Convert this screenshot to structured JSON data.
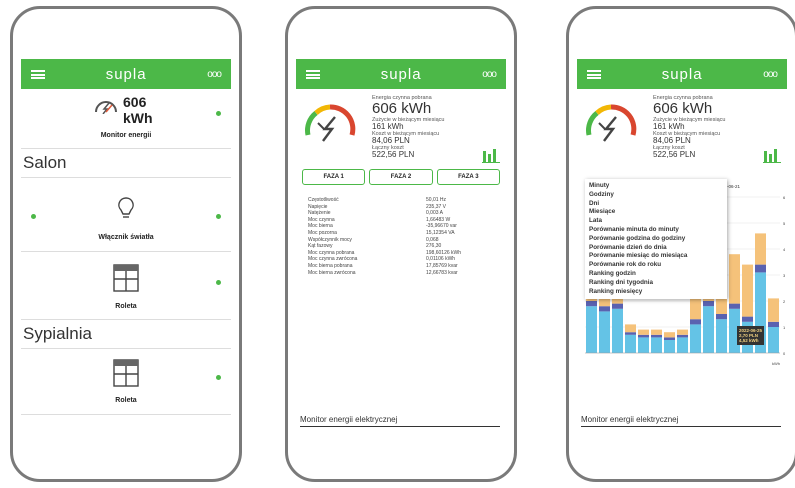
{
  "app": {
    "logo": "supla",
    "more": "ooo"
  },
  "phone1": {
    "energy_value": "606",
    "energy_unit": "kWh",
    "energy_label": "Monitor energii",
    "sections": [
      {
        "title": "Salon"
      },
      {
        "title": "Sypialnia"
      }
    ],
    "light_label": "Włącznik światła",
    "roller1_label": "Roleta",
    "roller2_label": "Roleta"
  },
  "monitor": {
    "top_caption": "Energia czynna pobrana",
    "total": "606 kWh",
    "month_caption": "Zużycie w bieżącym miesiącu",
    "month_value": "161 kWh",
    "cost_caption": "Koszt w bieżącym miesiącu",
    "cost_value": "84,06 PLN",
    "total_cost_caption": "Łączny koszt",
    "total_cost_value": "522,56 PLN",
    "footer": "Monitor energii elektrycznej"
  },
  "phone2": {
    "tabs": [
      "FAZA 1",
      "FAZA 2",
      "FAZA 3"
    ],
    "rows": [
      [
        "Częstotliwość",
        "50,01 Hz"
      ],
      [
        "Napięcie",
        "235,37 V"
      ],
      [
        "Natężenie",
        "0,003 A"
      ],
      [
        "Moc czynna",
        "1,66483 W"
      ],
      [
        "Moc bierna",
        "-35,96670 var"
      ],
      [
        "Moc pozorna",
        "15,12354 VA"
      ],
      [
        "Współczynnik mocy",
        "0,068"
      ],
      [
        "Kąt fazowy",
        "276,30"
      ],
      [
        "Moc czynna pobrana",
        "198,60126 kWh"
      ],
      [
        "Moc czynna zwrócona",
        "0,01106 kWh"
      ],
      [
        "Moc bierna pobrana",
        "17,85769 kvar"
      ],
      [
        "Moc bierna zwrócona",
        "12,66783 kvar"
      ]
    ]
  },
  "phone3": {
    "dropdown": [
      "Minuty",
      "Godziny",
      "Dni",
      "Miesiące",
      "Lata",
      "Porównanie minuta do minuty",
      "Porównanie godzina do godziny",
      "Porównanie dzień do dnia",
      "Porównanie miesiąc do miesiąca",
      "Porównanie rok do roku",
      "Ranking godzin",
      "Ranking dni tygodnia",
      "Ranking miesięcy"
    ],
    "date_label": "2022-06-21",
    "tooltip": [
      "2022-06-25",
      "2,70 PLN",
      "4,52 kWh"
    ],
    "axis_right": [
      "6",
      "5",
      "4",
      "3",
      "2",
      "1",
      "0"
    ],
    "axis_unit": "kWh"
  },
  "colors": {
    "green": "#4cb848",
    "bar_blue": "#64c3e6",
    "bar_orange": "#f5c27a"
  },
  "chart_data": {
    "type": "bar",
    "title": "",
    "categories": [
      "1",
      "2",
      "3",
      "4",
      "5",
      "6",
      "7",
      "8",
      "9",
      "10",
      "11",
      "12",
      "13",
      "14",
      "15"
    ],
    "series": [
      {
        "values": [
          1.8,
          1.6,
          1.7,
          0.7,
          0.6,
          0.6,
          0.5,
          0.6,
          1.1,
          1.8,
          1.3,
          1.7,
          1.2,
          3.1,
          1.0
        ]
      },
      {
        "values": [
          0.2,
          0.2,
          0.2,
          0.1,
          0.1,
          0.1,
          0.1,
          0.1,
          0.2,
          0.2,
          0.2,
          0.2,
          0.2,
          0.3,
          0.2
        ]
      },
      {
        "values": [
          0.6,
          0.5,
          0.6,
          0.3,
          0.2,
          0.2,
          0.2,
          0.2,
          0.8,
          1.6,
          1.4,
          1.9,
          2.0,
          1.2,
          0.9
        ]
      }
    ],
    "ylim": [
      0,
      6
    ]
  }
}
